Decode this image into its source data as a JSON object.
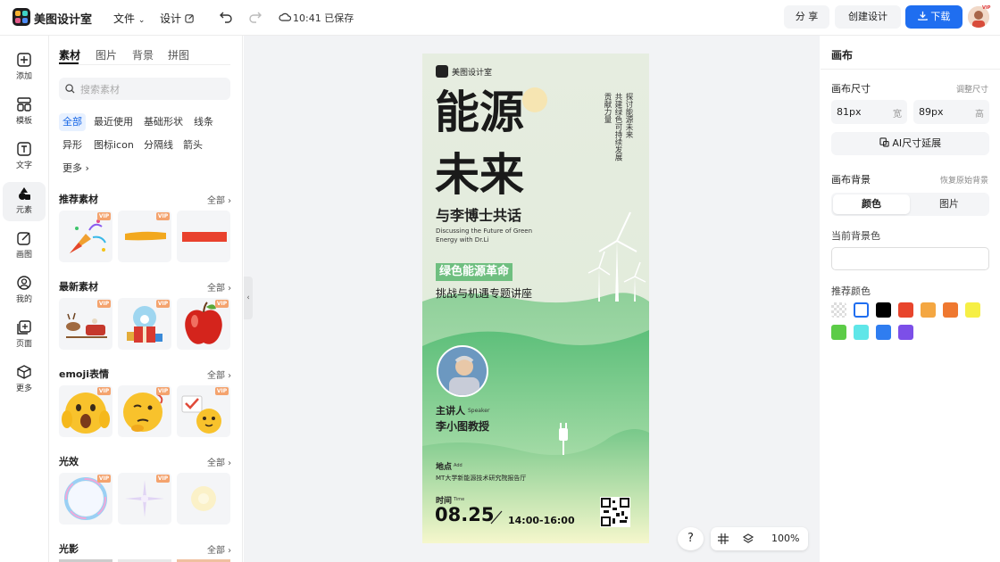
{
  "app": {
    "name": "美图设计室"
  },
  "topbar": {
    "file_menu": "文件",
    "design_menu": "设计",
    "saved_status": "10:41 已保存",
    "share_label": "分 享",
    "create_label": "创建设计",
    "download_label": "下载",
    "avatar_badge": "VIP",
    "download_color": "#1f6ef0"
  },
  "leftnav": {
    "items": [
      {
        "label": "添加",
        "icon": "plus-square-icon"
      },
      {
        "label": "模板",
        "icon": "template-icon"
      },
      {
        "label": "文字",
        "icon": "text-icon"
      },
      {
        "label": "元素",
        "icon": "shapes-icon"
      },
      {
        "label": "画图",
        "icon": "edit-icon"
      },
      {
        "label": "我的",
        "icon": "user-icon"
      },
      {
        "label": "页面",
        "icon": "add-page-icon"
      },
      {
        "label": "更多",
        "icon": "cube-icon"
      }
    ]
  },
  "panel": {
    "tabs": [
      "素材",
      "图片",
      "背景",
      "拼图"
    ],
    "search_placeholder": "搜索素材",
    "chips": [
      "全部",
      "最近使用",
      "基础形状",
      "线条",
      "异形",
      "图标icon",
      "分隔线",
      "箭头",
      "更多"
    ],
    "all_label": "全部",
    "vip_label": "VIP",
    "sections": [
      "推荐素材",
      "最新素材",
      "emoji表情",
      "光效",
      "光影"
    ]
  },
  "poster": {
    "logo_text": "美图设计室",
    "title_1": "能源",
    "title_2": "未来",
    "subtitle": "与李博士共话",
    "english": "Discussing the Future of Green Energy with Dr.Li",
    "vertical_1": "探讨能源未来",
    "vertical_2": "共建绿色可持续发展",
    "vertical_3": "贡献力量",
    "tag": "绿色能源革命",
    "tagline": "挑战与机遇专题讲座",
    "speaker_label": "主讲人",
    "speaker_en": "Speaker",
    "speaker_name": "李小图教授",
    "location_label": "地点",
    "location_en": "Add",
    "location": "MT大学新能源技术研究院报告厅",
    "time_label": "时间",
    "time_en": "Time",
    "date": "08.25",
    "time": "14:00-16:00"
  },
  "bottombar": {
    "help": "?",
    "zoom": "100%"
  },
  "right": {
    "title": "画布",
    "size_label": "画布尺寸",
    "adjust_size": "调整尺寸",
    "width_value": "81px",
    "width_unit": "宽",
    "height_value": "89px",
    "height_unit": "高",
    "ai_extend": "AI尺寸延展",
    "bg_label": "画布背景",
    "restore_bg": "恢复原始背景",
    "seg_color": "颜色",
    "seg_image": "图片",
    "current_bg": "当前背景色",
    "recommend": "推荐颜色",
    "swatches": [
      "transparent",
      "#ffffff",
      "#000000",
      "#e8452c",
      "#f4a742",
      "#ef7830",
      "#f6ef45",
      "#5ccc47",
      "#5fe6e8",
      "#2f7df0",
      "#7c4fe8"
    ]
  }
}
